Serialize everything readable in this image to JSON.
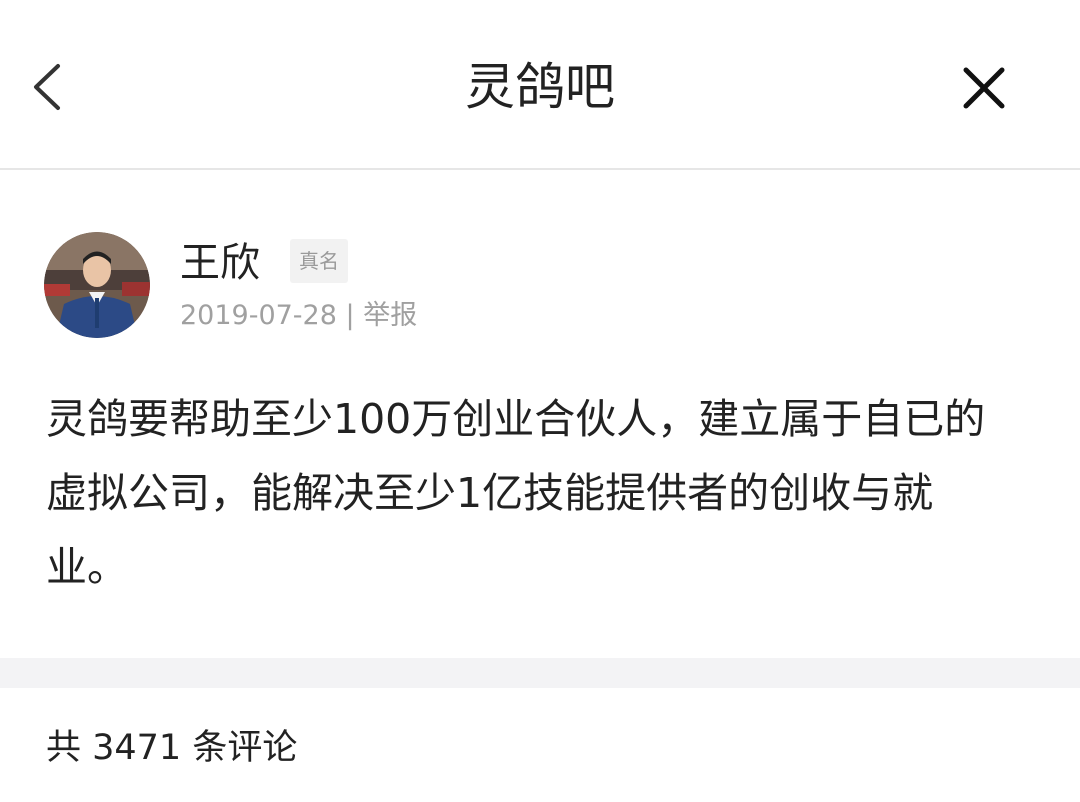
{
  "header": {
    "title": "灵鸽吧",
    "back_icon": "chevron-left-icon",
    "close_icon": "close-icon"
  },
  "post": {
    "author": {
      "name": "王欣",
      "badge": "真名",
      "avatar": "avatar-photo"
    },
    "date": "2019-07-28",
    "separator": "|",
    "report_label": "举报",
    "body": "灵鸽要帮助至少100万创业合伙人，建立属于自已的虚拟公司，能解决至少1亿技能提供者的创收与就业。"
  },
  "comments": {
    "count_text": "共 3471 条评论"
  },
  "colors": {
    "text_primary": "#222222",
    "text_secondary": "#a0a0a0",
    "badge_bg": "#f2f2f2",
    "band_bg": "#f3f3f5",
    "divider": "#e6e6e6"
  }
}
